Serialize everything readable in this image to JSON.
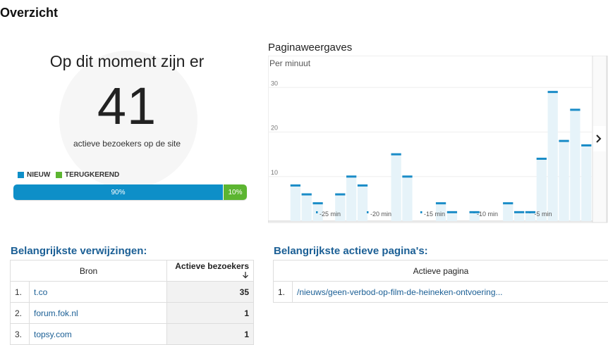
{
  "page": {
    "title": "Overzicht"
  },
  "realtime": {
    "headline": "Op dit moment zijn er",
    "count": "41",
    "caption": "actieve bezoekers op de site",
    "legend": {
      "new": "NIEUW",
      "returning": "TERUGKEREND"
    },
    "split": {
      "new_percent": 90,
      "new_label": "90%",
      "returning_percent": 10,
      "returning_label": "10%"
    },
    "colors": {
      "new": "#0e8fc8",
      "returning": "#5cb531"
    }
  },
  "chart_data": {
    "type": "bar",
    "title": "Paginaweergaves",
    "subtitle": "Per minuut",
    "ylim": [
      0,
      34
    ],
    "y_ticks": [
      "10",
      "20",
      "30"
    ],
    "x_tick_labels": [
      "-25 min",
      "-20 min",
      "-15 min",
      "-10 min",
      "-5 min"
    ],
    "values": [
      0,
      0,
      8,
      6,
      4,
      0,
      6,
      10,
      8,
      0,
      0,
      15,
      10,
      0,
      0,
      4,
      2,
      0,
      2,
      0,
      0,
      4,
      2,
      2,
      14,
      29,
      18,
      25,
      17
    ],
    "bar_color": "#e6f3f9",
    "cap_color": "#1a8cc7",
    "grid": true,
    "next_icon": "chevron-right-icon"
  },
  "referrals": {
    "title": "Belangrijkste verwijzingen:",
    "columns": {
      "source": "Bron",
      "active": "Actieve bezoekers",
      "sort_icon": "arrow-down-icon"
    },
    "rows": [
      {
        "num": "1.",
        "source": "t.co",
        "active": "35"
      },
      {
        "num": "2.",
        "source": "forum.fok.nl",
        "active": "1"
      },
      {
        "num": "3.",
        "source": "topsy.com",
        "active": "1"
      }
    ]
  },
  "active_pages": {
    "title": "Belangrijkste actieve pagina's:",
    "columns": {
      "page": "Actieve pagina"
    },
    "rows": [
      {
        "num": "1.",
        "page": "/nieuws/geen-verbod-op-film-de-heineken-ontvoering..."
      }
    ]
  }
}
